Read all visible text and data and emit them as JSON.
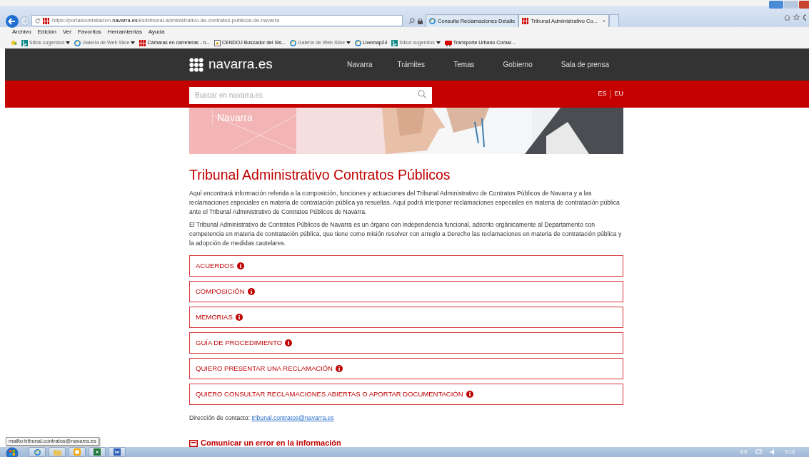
{
  "browser": {
    "address": "https://portalcontratacion.**navarra.es**/es/tribunal-administrativo-de-contratos-publicos-de-navarra",
    "tabs": [
      {
        "title": "Consulta Reclamaciones Detalle",
        "selected": false,
        "kind": "ie"
      },
      {
        "title": "Tribunal Administrativo Co...",
        "selected": true,
        "kind": "site",
        "close": "×"
      }
    ],
    "menu": [
      "Archivo",
      "Edición",
      "Ver",
      "Favoritos",
      "Herramientas",
      "Ayuda"
    ],
    "favorites": [
      {
        "label": "Sitios sugeridos",
        "kind": "bing",
        "dropdown": true
      },
      {
        "label": "Galería de Web Slice",
        "kind": "ie",
        "dropdown": true
      },
      {
        "label": "Cámaras en carreteras - n...",
        "kind": "site",
        "dropdown": false
      },
      {
        "label": "CENDOJ  Buscador del Sis...",
        "kind": "doc",
        "dropdown": false
      },
      {
        "label": "Galería de Web Slice",
        "kind": "ie",
        "dropdown": true
      },
      {
        "label": "Livemap24",
        "kind": "ie",
        "dropdown": false
      },
      {
        "label": "Sitios sugeridos",
        "kind": "bing",
        "dropdown": true
      },
      {
        "label": "Transporte Urbano Comar...",
        "kind": "bus",
        "dropdown": false
      }
    ]
  },
  "site": {
    "logo": "navarra.es",
    "nav": [
      "Navarra",
      "Trámites",
      "Temas",
      "Gobierno",
      "Sala de prensa"
    ],
    "search": {
      "placeholder": "Buscar en navarra.es"
    },
    "languages": [
      {
        "code": "ES"
      },
      {
        "code": "EU"
      }
    ],
    "banner": {
      "kind": "picture",
      "title": "Navarra"
    },
    "title": "Tribunal Administrativo Contratos Públicos",
    "paragraphs": [
      "Aquí encontrará información referida a la composición, funciones y actuaciones del Tribunal Administrativo de Contratos Públicos de Navarra y a las reclamaciones especiales en materia de contratación pública ya resueltas. Aquí podrá interponer reclamaciones especiales en materia de contratación pública ante el Tribunal Administrativo de Contratos Públicos de Navarra.",
      "El Tribunal Administrativo de Contratos Públicos de Navarra es un órgano con independencia funcional, adscrito orgánicamente al Departamento con competencia en materia de contratación pública, que tiene como misión resolver con arreglo a Derecho las reclamaciones en materia de contratación pública y la adopción de medidas cautelares."
    ],
    "sections": [
      "ACUERDOS",
      "COMPOSICIÓN",
      "MEMORIAS",
      "GUÍA DE PROCEDIMIENTO",
      "QUIERO PRESENTAR UNA RECLAMACIÓN",
      "QUIERO CONSULTAR RECLAMACIONES ABIERTAS O APORTAR DOCUMENTACIÓN"
    ],
    "contact": {
      "label": "Dirección de contacto:",
      "email": "tribunal.contratos@navarra.es"
    },
    "report_link": "Comunicar un error en la información"
  },
  "status_tooltip": "mailto:tribunal.contratos@navarra.es",
  "taskbar": {
    "apps": [
      {
        "kind": "ie"
      },
      {
        "kind": "folder"
      },
      {
        "kind": "clock"
      },
      {
        "kind": "excel"
      },
      {
        "kind": "word"
      }
    ],
    "language": "ES",
    "time": "9:13"
  }
}
